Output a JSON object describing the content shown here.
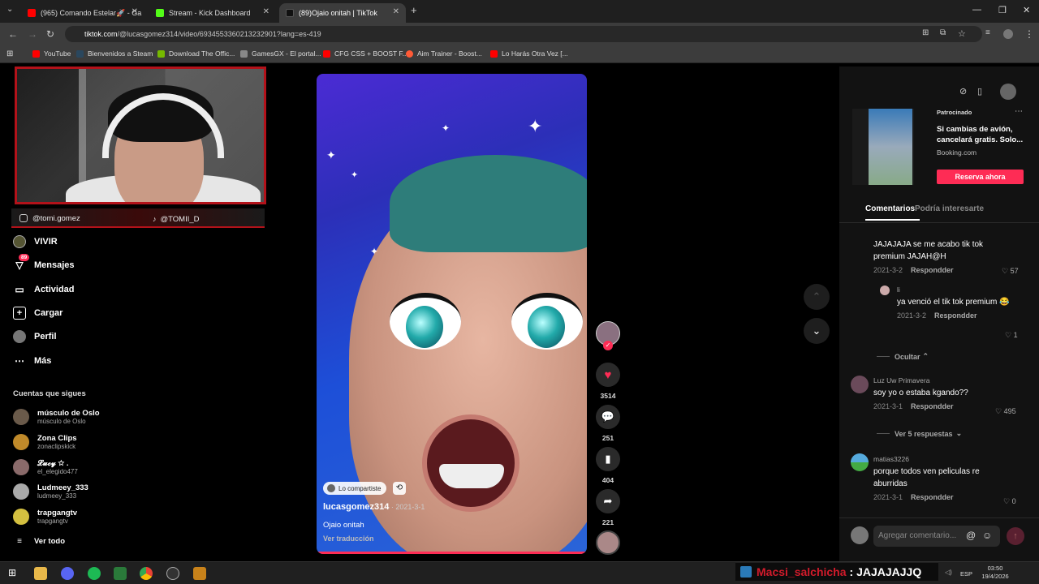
{
  "browser": {
    "tabs": [
      {
        "title": "(965) Comando Estelar🚀 - Ga",
        "icon_color": "#ff0000"
      },
      {
        "title": "Stream - Kick Dashboard",
        "icon_color": "#53fc18"
      },
      {
        "title": "(89)Ojaio onitah | TikTok",
        "icon_color": "#000000"
      }
    ],
    "new_tab": "+",
    "url_host": "tiktok.com",
    "url_path": "/@lucasgomez314/video/6934553360213232901?lang=es-419",
    "bookmarks": [
      {
        "label": "YouTube",
        "color": "#ff0000"
      },
      {
        "label": "Bienvenidos a Steam",
        "color": "#1b2838"
      },
      {
        "label": "Download The Offic...",
        "color": "#76b900"
      },
      {
        "label": "GamesGX - El portal...",
        "color": "#888888"
      },
      {
        "label": "CFG CSS + BOOST F...",
        "color": "#ff0000"
      },
      {
        "label": "Aim Trainer - Boost...",
        "color": "#ff5a36"
      },
      {
        "label": "Lo Harás Otra Vez [...",
        "color": "#ff0000"
      }
    ]
  },
  "stream_overlay": {
    "instagram": "@tomi.gomez",
    "tiktok": "@TOMII_D"
  },
  "sidebar": {
    "nav": [
      {
        "label": "VIVIR",
        "icon": "live-icon"
      },
      {
        "label": "Mensajes",
        "icon": "messages-icon",
        "badge": "89"
      },
      {
        "label": "Actividad",
        "icon": "activity-icon"
      },
      {
        "label": "Cargar",
        "icon": "upload-icon"
      },
      {
        "label": "Perfil",
        "icon": "profile-icon"
      },
      {
        "label": "Más",
        "icon": "more-icon"
      }
    ],
    "following_title": "Cuentas que sigues",
    "following": [
      {
        "name": "músculo de Oslo",
        "handle": "músculo de Oslo",
        "color": "#6a5a4a"
      },
      {
        "name": "Zona Clips",
        "handle": "zonaclipskick",
        "color": "#c08a2a"
      },
      {
        "name": "𝓛𝓾𝓬𝔂 ☆ .",
        "handle": "el_elegido477",
        "color": "#8a6a6a"
      },
      {
        "name": "Ludmeey_333",
        "handle": "ludmeey_333",
        "color": "#aaaaaa"
      },
      {
        "name": "trapgangtv",
        "handle": "trapgangtv",
        "color": "#d4c040"
      }
    ],
    "see_all": "Ver todo"
  },
  "video": {
    "shared_label": "Lo compartiste",
    "author": "lucasgomez314",
    "date": "2021-3-1",
    "caption": "Ojaio onitah",
    "translate": "Ver traducción",
    "likes": "3514",
    "comments": "251",
    "saves": "404",
    "shares": "221",
    "progress": 1.0
  },
  "ad": {
    "sponsored": "Patrocinado",
    "text": "Si cambias de avión, cancelará gratis. Solo...",
    "brand": "Booking.com",
    "cta": "Reserva ahora"
  },
  "comments_panel": {
    "tabs": [
      "Comentarios",
      "Podría interesarte"
    ],
    "comments": [
      {
        "text": "JAJAJAJA se me acabo tik tok premium JAJAH@H",
        "date": "2021-3-2",
        "reply": "Respondder",
        "likes": "57"
      },
      {
        "user": "li",
        "text": "ya venció el tik tok premium 😂",
        "date": "2021-3-2",
        "reply": "Respondder",
        "likes": "1"
      },
      {
        "user": "Luz Uw Primavera",
        "text": "soy yo o estaba kgando??",
        "date": "2021-3-1",
        "reply": "Respondder",
        "likes": "495"
      },
      {
        "user": "matias3226",
        "text": "porque todos ven peliculas re aburridas",
        "date": "2021-3-1",
        "reply": "Respondder",
        "likes": "0"
      }
    ],
    "hide_label": "Ocultar",
    "more_replies": "Ver 5 respuestas",
    "input_placeholder": "Agregar comentario..."
  },
  "taskbar": {
    "chat_user": "Macsi_salchicha",
    "chat_msg": ": JAJAJAJJQ",
    "lang": "ESP",
    "time": "03:50",
    "date": "19/4/2026"
  }
}
